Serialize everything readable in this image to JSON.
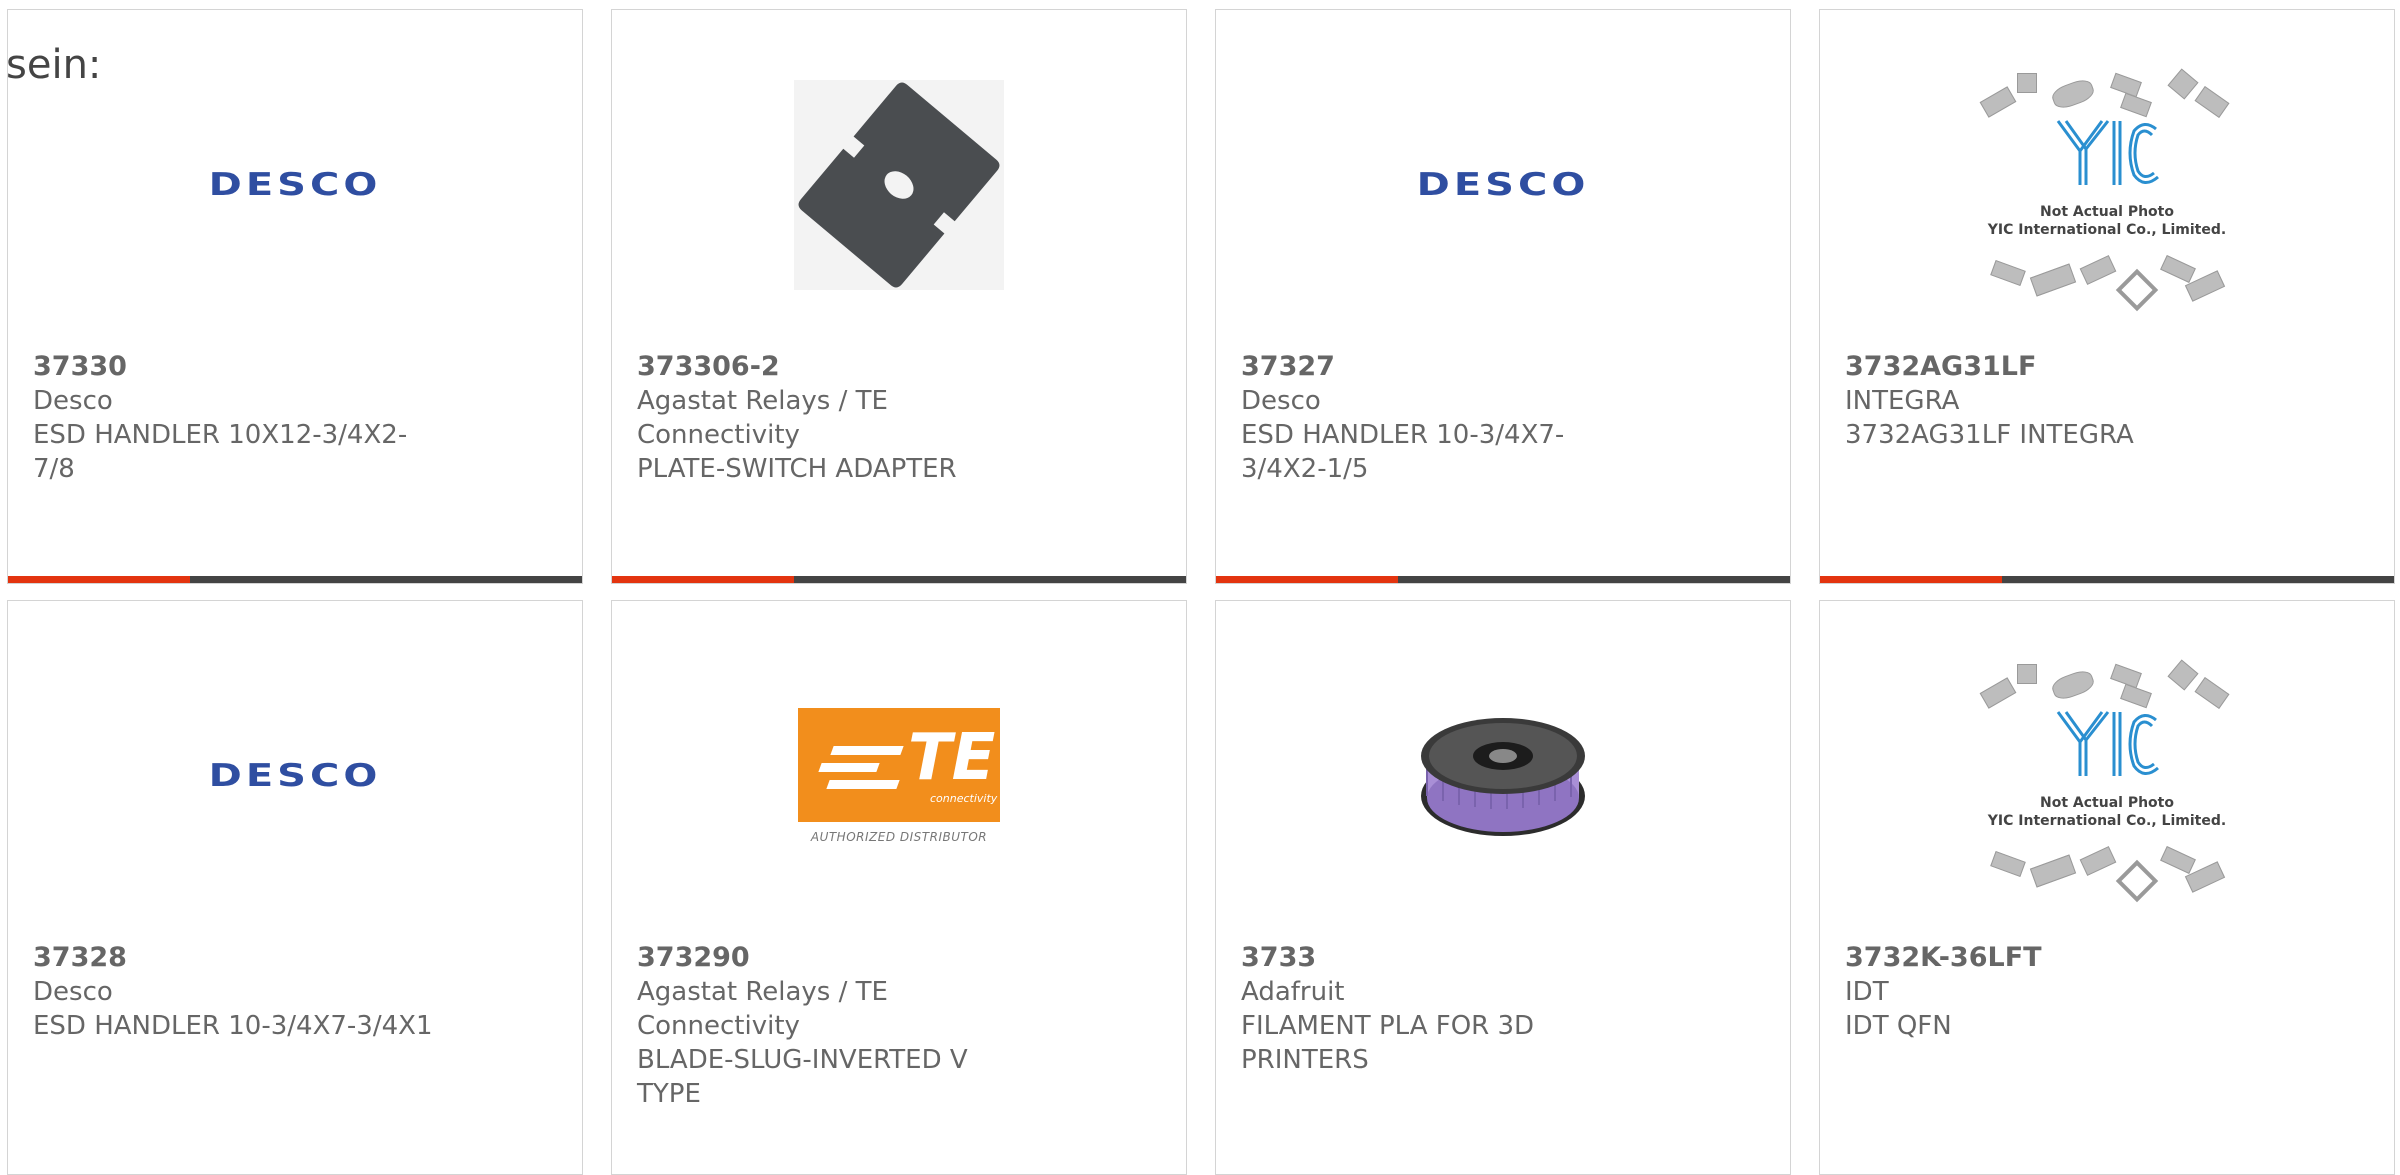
{
  "intro_text": "sein:",
  "products": [
    {
      "part_number": "37330",
      "manufacturer": "Desco",
      "description": "ESD HANDLER 10X12-3/4X2-7/8",
      "image": "desco-logo",
      "logo_text": "DESCO"
    },
    {
      "part_number": "373306-2",
      "manufacturer": "Agastat Relays / TE Connectivity",
      "description": "PLATE-SWITCH ADAPTER",
      "image": "plate-photo"
    },
    {
      "part_number": "37327",
      "manufacturer": "Desco",
      "description": "ESD HANDLER 10-3/4X7-3/4X2-1/5",
      "image": "desco-logo",
      "logo_text": "DESCO"
    },
    {
      "part_number": "3732AG31LF",
      "manufacturer": "INTEGRA",
      "description": "3732AG31LF INTEGRA",
      "image": "yic-placeholder",
      "image_note_1": "Not Actual Photo",
      "image_note_2": "YIC International Co., Limited."
    },
    {
      "part_number": "37328",
      "manufacturer": "Desco",
      "description": "ESD HANDLER 10-3/4X7-3/4X1",
      "image": "desco-logo",
      "logo_text": "DESCO"
    },
    {
      "part_number": "373290",
      "manufacturer": "Agastat Relays / TE Connectivity",
      "description": "BLADE-SLUG-INVERTED V TYPE",
      "image": "te-logo",
      "logo_text": "TE",
      "logo_sub": "connectivity",
      "logo_caption": "AUTHORIZED DISTRIBUTOR"
    },
    {
      "part_number": "3733",
      "manufacturer": "Adafruit",
      "description": "FILAMENT PLA FOR 3D PRINTERS",
      "image": "filament-spool-photo"
    },
    {
      "part_number": "3732K-36LFT",
      "manufacturer": "IDT",
      "description": "IDT QFN",
      "image": "yic-placeholder",
      "image_note_1": "Not Actual Photo",
      "image_note_2": "YIC International Co., Limited."
    }
  ],
  "colors": {
    "accent": "#e3340f",
    "bar": "#444444",
    "text": "#666666",
    "desco_blue": "#2f4ea1",
    "te_orange": "#f28e1c",
    "border": "#d4d4d4"
  }
}
